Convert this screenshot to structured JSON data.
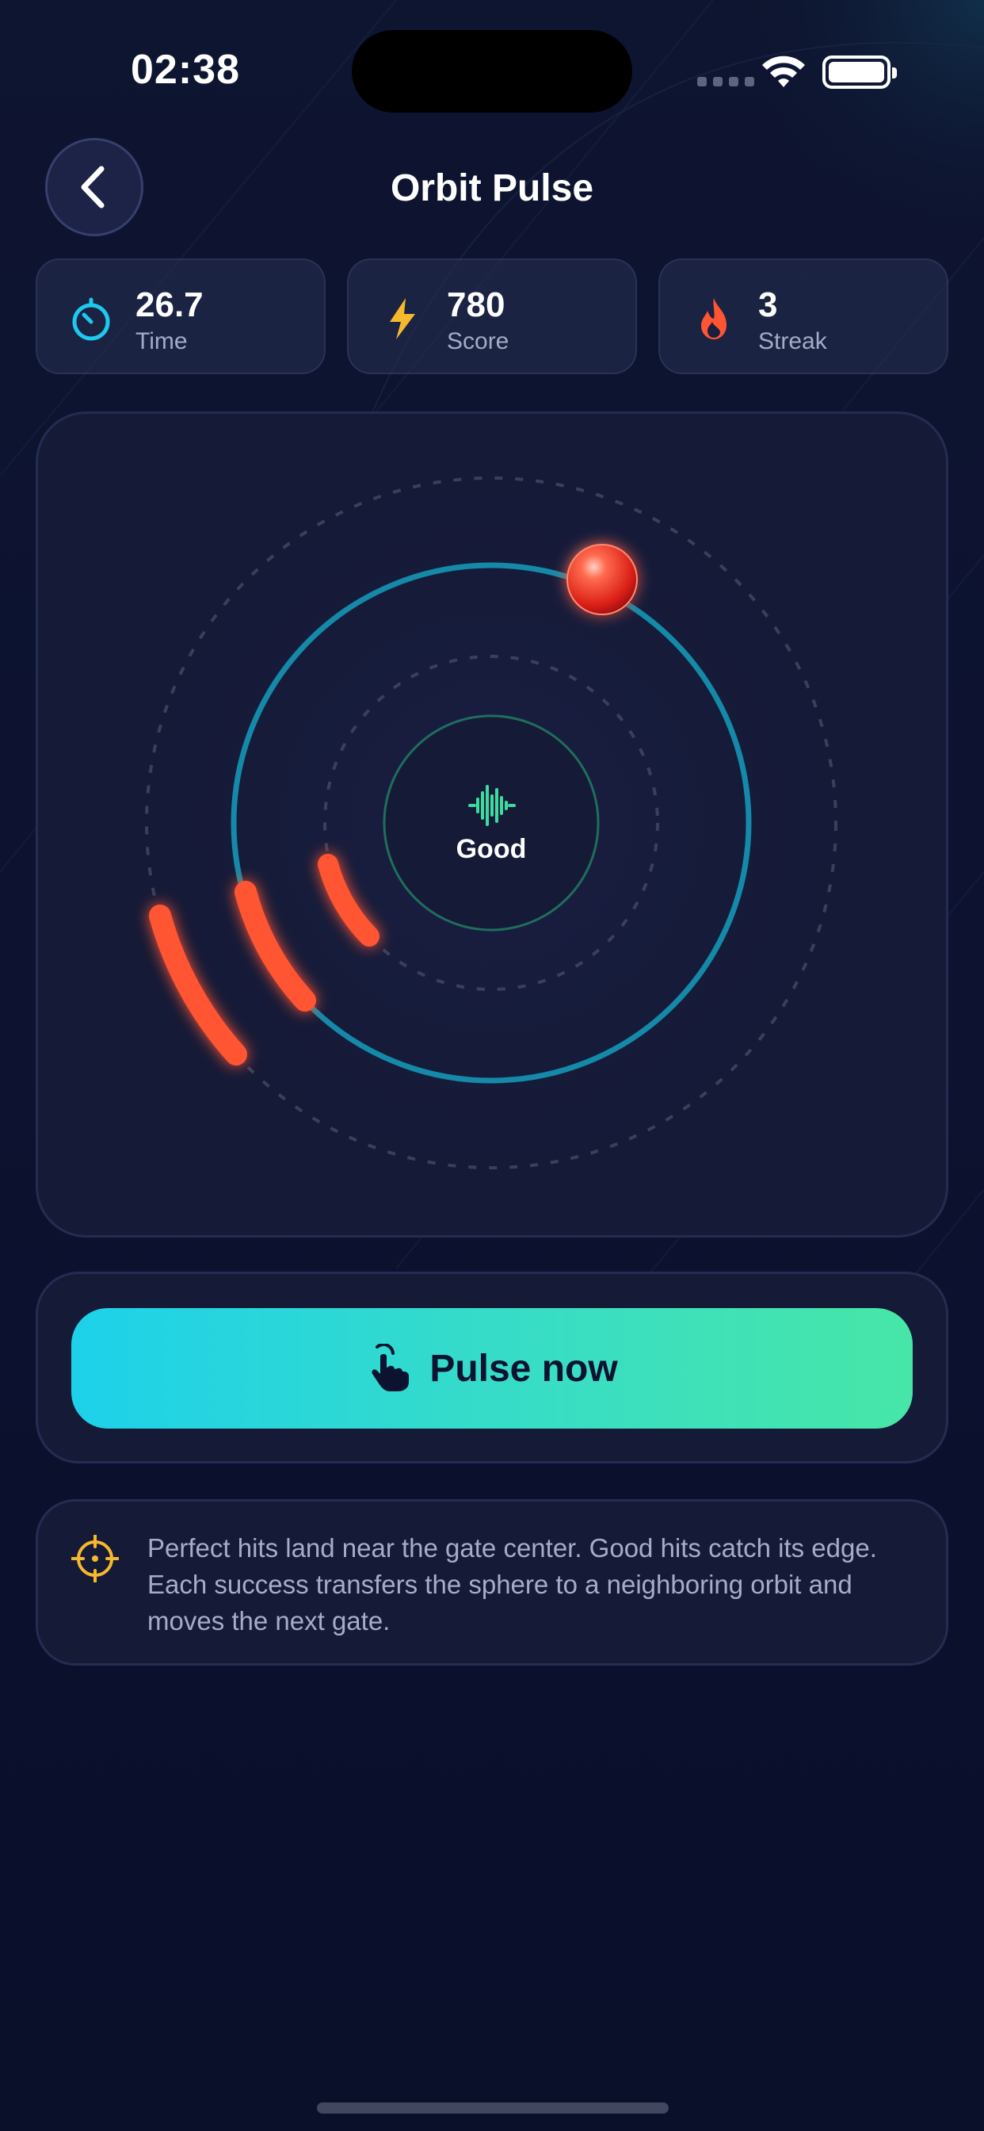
{
  "status_bar": {
    "time": "02:38"
  },
  "header": {
    "title": "Orbit Pulse",
    "back_icon": "chevron-left-icon"
  },
  "stats": [
    {
      "icon": "stopwatch-icon",
      "value": "26.7",
      "label": "Time",
      "color": "#1ec8ee"
    },
    {
      "icon": "lightning-icon",
      "value": "780",
      "label": "Score",
      "color": "#f6b82c"
    },
    {
      "icon": "flame-icon",
      "value": "3",
      "label": "Streak",
      "color": "#ff5532"
    }
  ],
  "game": {
    "feedback": "Good",
    "feedback_icon": "soundwave-icon",
    "colors": {
      "active_orbit": "#1589a8",
      "gate": "#ff5532",
      "sphere": "#ff3b30",
      "core_ring": "#1f6e5c"
    }
  },
  "pulse_button": {
    "label": "Pulse now",
    "icon": "hand-tap-icon"
  },
  "tip": {
    "icon": "crosshair-icon",
    "text": "Perfect hits land near the gate center. Good hits catch its edge. Each success transfers the sphere to a neighboring orbit and moves the next gate."
  }
}
